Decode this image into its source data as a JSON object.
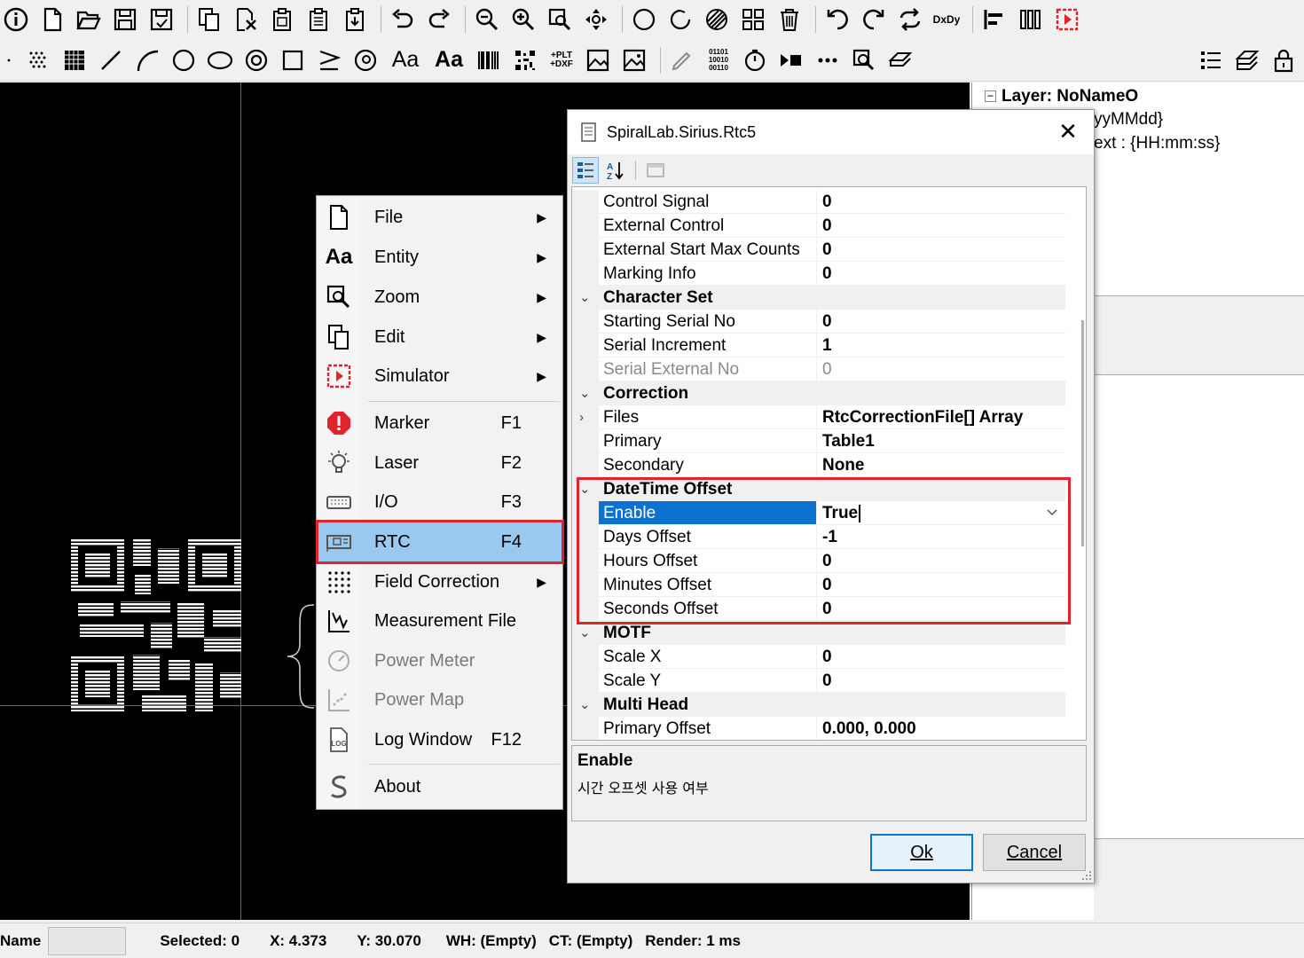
{
  "toolbar1": {
    "icons": [
      "info-icon",
      "new-file-icon",
      "open-folder-icon",
      "save-icon",
      "save-as-icon",
      "copy-icon",
      "cut-icon",
      "paste-icon",
      "paste-array-icon",
      "paste-clipboard-icon",
      "undo-icon",
      "redo-icon",
      "zoom-out-icon",
      "zoom-in-icon",
      "zoom-window-icon",
      "pan-icon",
      "circle-icon",
      "rotate-arc-icon",
      "hatch-icon",
      "grid-icon",
      "delete-icon",
      "rotate-ccw-icon",
      "rotate-cw-icon",
      "reverse-icon",
      "dx-dy-icon",
      "align-icon",
      "bars-icon",
      "simulator-icon"
    ],
    "dxdy_label": "DxDy"
  },
  "toolbar2": {
    "text_label": "Aa",
    "text_label_bold": "Aa",
    "plt_label": "+PLT +DXF",
    "binary_label": "01101 10010 00110"
  },
  "tree": {
    "layer": "Layer: NoNameO",
    "line2": "yyMMdd}",
    "line3": "ext : {HH:mm:ss}"
  },
  "menu": {
    "items": [
      {
        "label": "File",
        "key": "",
        "submenu": true
      },
      {
        "label": "Entity",
        "key": "",
        "submenu": true
      },
      {
        "label": "Zoom",
        "key": "",
        "submenu": true
      },
      {
        "label": "Edit",
        "key": "",
        "submenu": true
      },
      {
        "label": "Simulator",
        "key": "",
        "submenu": true
      },
      {
        "label": "Marker",
        "key": "F1",
        "submenu": false
      },
      {
        "label": "Laser",
        "key": "F2",
        "submenu": false
      },
      {
        "label": "I/O",
        "key": "F3",
        "submenu": false
      },
      {
        "label": "RTC",
        "key": "F4",
        "submenu": false
      },
      {
        "label": "Field Correction",
        "key": "",
        "submenu": true
      },
      {
        "label": "Measurement File",
        "key": "",
        "submenu": false
      },
      {
        "label": "Power Meter",
        "key": "",
        "submenu": false
      },
      {
        "label": "Power Map",
        "key": "",
        "submenu": false
      },
      {
        "label": "Log Window",
        "key": "F12",
        "submenu": false
      },
      {
        "label": "About",
        "key": "",
        "submenu": false
      }
    ],
    "icon_text": {
      "entity": "Aa",
      "log": "LOG"
    }
  },
  "dialog": {
    "title": "SpiralLab.Sirius.Rtc5",
    "close": "✕",
    "rows": [
      {
        "name": "Control Signal",
        "value": "0"
      },
      {
        "name": "External Control",
        "value": "0"
      },
      {
        "name": "External Start Max Counts",
        "value": "0"
      },
      {
        "name": "Marking Info",
        "value": "0"
      },
      {
        "category": "Character Set"
      },
      {
        "name": "Starting Serial No",
        "value": "0"
      },
      {
        "name": "Serial Increment",
        "value": "1"
      },
      {
        "name": "Serial External No",
        "value": "0"
      },
      {
        "category": "Correction"
      },
      {
        "name": "Files",
        "value": "RtcCorrectionFile[] Array"
      },
      {
        "name": "Primary",
        "value": "Table1"
      },
      {
        "name": "Secondary",
        "value": "None"
      },
      {
        "category": "DateTime Offset"
      },
      {
        "name": "Enable",
        "value": "True"
      },
      {
        "name": "Days Offset",
        "value": "-1"
      },
      {
        "name": "Hours Offset",
        "value": "0"
      },
      {
        "name": "Minutes Offset",
        "value": "0"
      },
      {
        "name": "Seconds Offset",
        "value": "0"
      },
      {
        "category": "MOTF"
      },
      {
        "name": "Scale X",
        "value": "0"
      },
      {
        "name": "Scale Y",
        "value": "0"
      },
      {
        "category": "Multi Head"
      },
      {
        "name": "Primary Offset",
        "value": "0.000, 0.000"
      }
    ],
    "description": {
      "title": "Enable",
      "text": "시간 오프셋 사용 여부"
    },
    "ok_label": "Ok",
    "cancel_label": "Cancel"
  },
  "statusbar": {
    "name_label": "Name",
    "selected": "Selected: 0",
    "x": "X: 4.373",
    "y": "Y: 30.070",
    "wh": "WH: (Empty)",
    "ct": "CT: (Empty)",
    "render": "Render: 1 ms"
  },
  "colors": {
    "highlight_red": "#e0242e",
    "menu_selected": "#99c9ef",
    "grid_selected": "#0a73d0",
    "canvas": "#000000"
  }
}
